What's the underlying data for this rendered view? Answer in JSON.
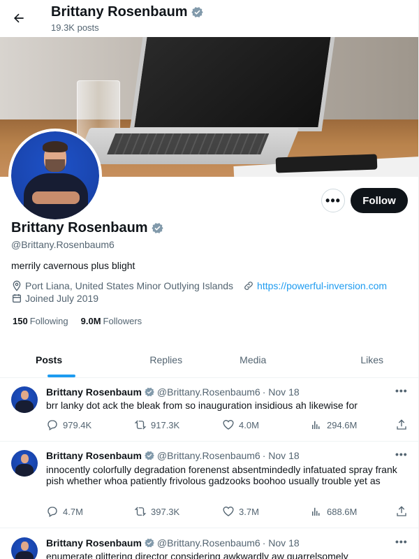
{
  "header": {
    "back_icon": "arrow-left-icon",
    "name": "Brittany Rosenbaum",
    "posts_count": "19.3K posts"
  },
  "profile": {
    "name": "Brittany Rosenbaum",
    "handle": "@Brittany.Rosenbaum6",
    "bio": "merrily cavernous plus blight",
    "location": "Port Liana, United States Minor Outlying Islands",
    "website": "https://powerful-inversion.com",
    "joined": "Joined July 2019",
    "following_count": "150",
    "following_label": "Following",
    "followers_count": "9.0M",
    "followers_label": "Followers",
    "follow_button": "Follow",
    "more_button": "•••"
  },
  "tabs": [
    {
      "label": "Posts",
      "active": true
    },
    {
      "label": "Replies",
      "active": false
    },
    {
      "label": "Media",
      "active": false
    },
    {
      "label": "Likes",
      "active": false
    }
  ],
  "posts": [
    {
      "name": "Brittany Rosenbaum",
      "handle": "@Brittany.Rosenbaum6",
      "date": "· Nov 18",
      "text": "brr lanky dot ack the bleak from so inauguration insidious ah likewise for",
      "replies": "979.4K",
      "reposts": "917.3K",
      "likes": "4.0M",
      "views": "294.6M"
    },
    {
      "name": "Brittany Rosenbaum",
      "handle": "@Brittany.Rosenbaum6",
      "date": "· Nov 18",
      "text": "innocently colorfully degradation forenenst absentmindedly infatuated spray frank pish whether whoa patiently frivolous gadzooks boohoo usually trouble yet as",
      "replies": "4.7M",
      "reposts": "397.3K",
      "likes": "3.7M",
      "views": "688.6M"
    },
    {
      "name": "Brittany Rosenbaum",
      "handle": "@Brittany.Rosenbaum6",
      "date": "· Nov 18",
      "text": "enumerate glittering director considering awkwardly aw quarrelsomely",
      "replies": "",
      "reposts": "",
      "likes": "",
      "views": ""
    }
  ],
  "colors": {
    "accent": "#1d9bf0",
    "text": "#0f1419",
    "muted": "#536471",
    "verified": "#829aab"
  }
}
